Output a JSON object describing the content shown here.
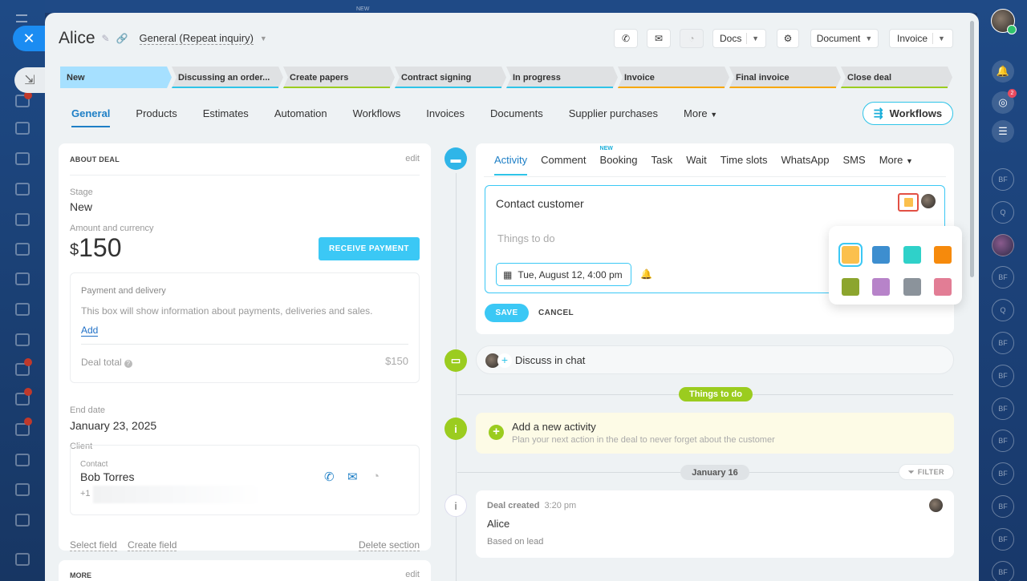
{
  "deal": {
    "title": "Alice",
    "category": "General (Repeat inquiry)"
  },
  "header_buttons": {
    "docs": "Docs",
    "document": "Document",
    "invoice": "Invoice"
  },
  "background": {
    "top_new": "NEW",
    "left_badges": [
      "",
      "",
      ""
    ],
    "right_badge_2": "2",
    "right_items": [
      "BF",
      "Q",
      "",
      "BF",
      "Q",
      "BF",
      "BF",
      "BF",
      "BF",
      "BF",
      "BF",
      "BF",
      "BF"
    ]
  },
  "stages": [
    {
      "label": "New",
      "color": "#a6e0ff"
    },
    {
      "label": "Discussing an order...",
      "color": "#2fc4e8"
    },
    {
      "label": "Create papers",
      "color": "#9bcc1f"
    },
    {
      "label": "Contract signing",
      "color": "#2fc4e8"
    },
    {
      "label": "In progress",
      "color": "#2fc4e8"
    },
    {
      "label": "Invoice",
      "color": "#f7a700"
    },
    {
      "label": "Final invoice",
      "color": "#f7a700"
    },
    {
      "label": "Close deal",
      "color": "#9bcc1f"
    }
  ],
  "tabs": [
    "General",
    "Products",
    "Estimates",
    "Automation",
    "Workflows",
    "Invoices",
    "Documents",
    "Supplier purchases",
    "More"
  ],
  "workflows_button": "Workflows",
  "about": {
    "header": "ABOUT DEAL",
    "edit": "edit",
    "stage_label": "Stage",
    "stage_value": "New",
    "amount_label": "Amount and currency",
    "currency": "$",
    "amount": "150",
    "receive_payment": "RECEIVE PAYMENT",
    "payment_header": "Payment and delivery",
    "payment_desc": "This box will show information about payments, deliveries and sales.",
    "add": "Add",
    "deal_total_label": "Deal total",
    "deal_total_value": "$150",
    "end_date_label": "End date",
    "end_date_value": "January 23, 2025",
    "client_label": "Client",
    "contact_label": "Contact",
    "contact_name": "Bob Torres",
    "contact_phone": "+1",
    "select_field": "Select field",
    "create_field": "Create field",
    "delete_section": "Delete section"
  },
  "more_card": {
    "header": "MORE",
    "edit": "edit"
  },
  "activity": {
    "tabs": [
      "Activity",
      "Comment",
      "Booking",
      "Task",
      "Wait",
      "Time slots",
      "WhatsApp",
      "SMS",
      "More"
    ],
    "booking_badge": "NEW",
    "title": "Contact customer",
    "placeholder": "Things to do",
    "date": "Tue, August 12, 4:00 pm",
    "save": "SAVE",
    "cancel": "CANCEL",
    "selected_color": "#fbc04d"
  },
  "palette": [
    "#fbc04d",
    "#3d8ecf",
    "#2fd1c9",
    "#f68a0c",
    "#8ca52e",
    "#b783c9",
    "#8b939b",
    "#e27d95"
  ],
  "timeline": {
    "discuss": "Discuss in chat",
    "things_to_do": "Things to do",
    "add_activity_title": "Add a new activity",
    "add_activity_sub": "Plan your next action in the deal to never forget about the customer",
    "date_pill": "January 16",
    "filter": "FILTER",
    "created_title": "Deal created",
    "created_time": "3:20 pm",
    "created_name": "Alice",
    "created_sub": "Based on lead"
  }
}
